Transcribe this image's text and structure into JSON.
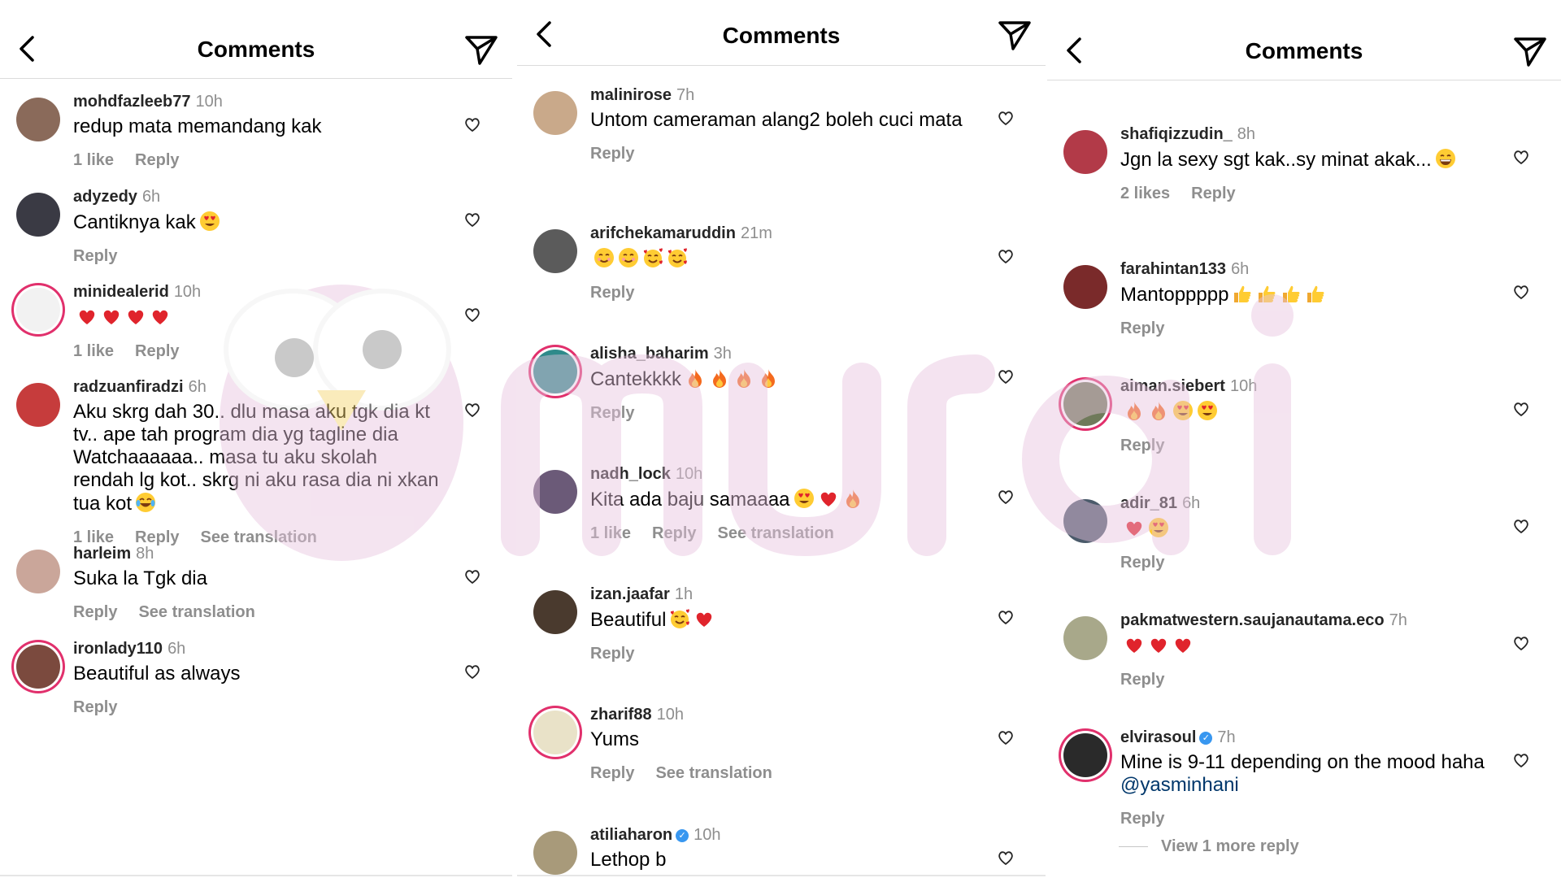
{
  "panels": [
    {
      "title": "Comments",
      "comments": [
        {
          "user": "mohdfazleeb77",
          "time": "10h",
          "text": "redup mata memandang kak",
          "likes": "1 like",
          "reply": "Reply"
        },
        {
          "user": "adyzedy",
          "time": "6h",
          "text": "Cantiknya kak",
          "emojis": [
            "heart-eyes"
          ],
          "reply": "Reply"
        },
        {
          "user": "minidealerid",
          "time": "10h",
          "text": "",
          "emojis": [
            "heart",
            "heart",
            "heart",
            "heart"
          ],
          "likes": "1 like",
          "reply": "Reply"
        },
        {
          "user": "radzuanfiradzi",
          "time": "6h",
          "text": "Aku skrg dah 30.. dlu masa aku tgk dia kt tv.. ape tah program dia yg tagline dia Watchaaaaaa.. masa tu aku skolah rendah lg kot.. skrg ni aku rasa dia ni xkan tua kot",
          "emojis": [
            "laugh"
          ],
          "likes": "1 like",
          "reply": "Reply",
          "translation": "See translation"
        },
        {
          "user": "harleim",
          "time": "8h",
          "text": "Suka la Tgk dia",
          "reply": "Reply",
          "translation": "See translation"
        },
        {
          "user": "ironlady110",
          "time": "6h",
          "text": "Beautiful as always",
          "reply": "Reply"
        }
      ]
    },
    {
      "title": "Comments",
      "comments": [
        {
          "user": "malinirose",
          "time": "7h",
          "text": "Untom cameraman alang2 boleh cuci mata",
          "reply": "Reply"
        },
        {
          "user": "arifchekamaruddin",
          "time": "21m",
          "text": "",
          "emojis": [
            "smile",
            "smile",
            "hearts-face",
            "hearts-face"
          ],
          "reply": "Reply"
        },
        {
          "user": "alisha_baharim",
          "time": "3h",
          "text": "Cantekkkk",
          "emojis": [
            "fire",
            "fire",
            "fire",
            "fire"
          ],
          "reply": "Reply"
        },
        {
          "user": "nadh_lock",
          "time": "10h",
          "text": "Kita ada baju samaaaa",
          "emojis": [
            "heart-eyes",
            "heart",
            "fire"
          ],
          "likes": "1 like",
          "reply": "Reply",
          "translation": "See translation"
        },
        {
          "user": "izan.jaafar",
          "time": "1h",
          "text": "Beautiful",
          "emojis": [
            "hearts-face",
            "heart"
          ],
          "reply": "Reply"
        },
        {
          "user": "zharif88",
          "time": "10h",
          "text": "Yums",
          "reply": "Reply",
          "translation": "See translation"
        },
        {
          "user": "atiliaharon",
          "time": "10h",
          "text": "Lethop b",
          "verified": true
        }
      ]
    },
    {
      "title": "Comments",
      "comments": [
        {
          "user": "shafiqizzudin_",
          "time": "8h",
          "text": "Jgn la sexy sgt kak..sy minat akak...",
          "emojis": [
            "grin"
          ],
          "likes": "2 likes",
          "reply": "Reply"
        },
        {
          "user": "farahintan133",
          "time": "6h",
          "text": "Mantoppppp",
          "emojis": [
            "thumbs",
            "thumbs",
            "thumbs",
            "thumbs"
          ],
          "reply": "Reply"
        },
        {
          "user": "aiman.siebert",
          "time": "10h",
          "text": "",
          "emojis": [
            "fire",
            "fire",
            "heart-eyes",
            "heart-eyes"
          ],
          "reply": "Reply"
        },
        {
          "user": "adir_81",
          "time": "6h",
          "text": "",
          "emojis": [
            "heart",
            "heart-eyes"
          ],
          "reply": "Reply"
        },
        {
          "user": "pakmatwestern.saujanautama.eco",
          "time": "7h",
          "text": "",
          "emojis": [
            "heart",
            "heart",
            "heart"
          ],
          "reply": "Reply"
        },
        {
          "user": "elvirasoul",
          "time": "7h",
          "text": "Mine is 9-11 depending on the mood haha",
          "mention": "@yasminhani",
          "verified": true,
          "reply": "Reply"
        }
      ],
      "view_more": "View 1 more reply"
    }
  ],
  "watermark": "murai",
  "colors": {
    "link": "#00376b",
    "muted": "#8e8e8e",
    "verified": "#3897f0",
    "watermark": "#e7c3de"
  }
}
